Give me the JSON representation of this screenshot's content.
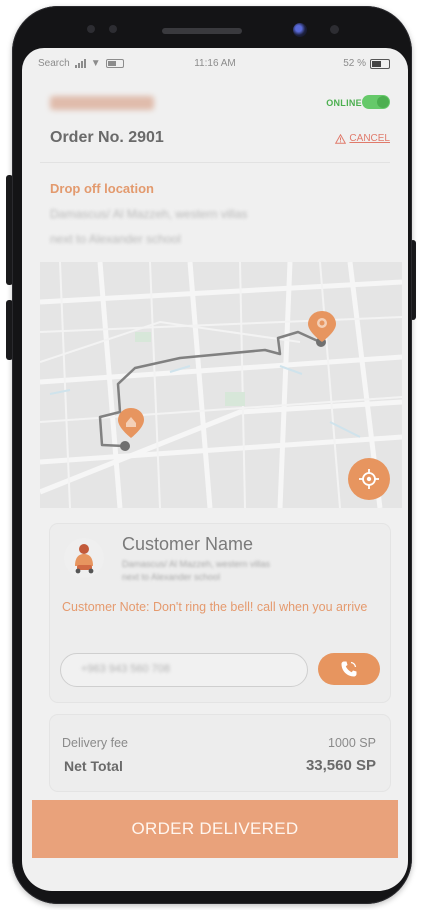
{
  "status_bar": {
    "carrier": "Search",
    "time": "11:16 AM",
    "battery": "52 %"
  },
  "header": {
    "online_label": "ONLINE",
    "online": true,
    "order_number": "Order No. 2901",
    "cancel_label": "CANCEL"
  },
  "dropoff": {
    "title": "Drop off location",
    "address_line1": "Damascus/ Al Mazzeh, western villas",
    "address_line2": "next to Alexander school"
  },
  "customer": {
    "name": "Customer Name",
    "address_line1": "Damascus/ Al Mazzeh, western villas",
    "address_line2": "next to Alexander school",
    "note": "Customer Note: Don't ring the bell! call when you arrive",
    "phone_value": "+963 943 560 708"
  },
  "totals": {
    "delivery_fee_label": "Delivery fee",
    "delivery_fee_value": "1000 SP",
    "net_total_label": "Net Total",
    "net_total_value": "33,560 SP"
  },
  "actions": {
    "order_delivered_label": "ORDER DELIVERED"
  },
  "colors": {
    "accent": "#e7955f",
    "online_green": "#4caf50",
    "cancel_red": "#e07a6b"
  },
  "icons": [
    "signal-icon",
    "wifi-icon",
    "battery-icon",
    "warning-icon",
    "pin-icon",
    "locate-icon",
    "phone-icon"
  ]
}
